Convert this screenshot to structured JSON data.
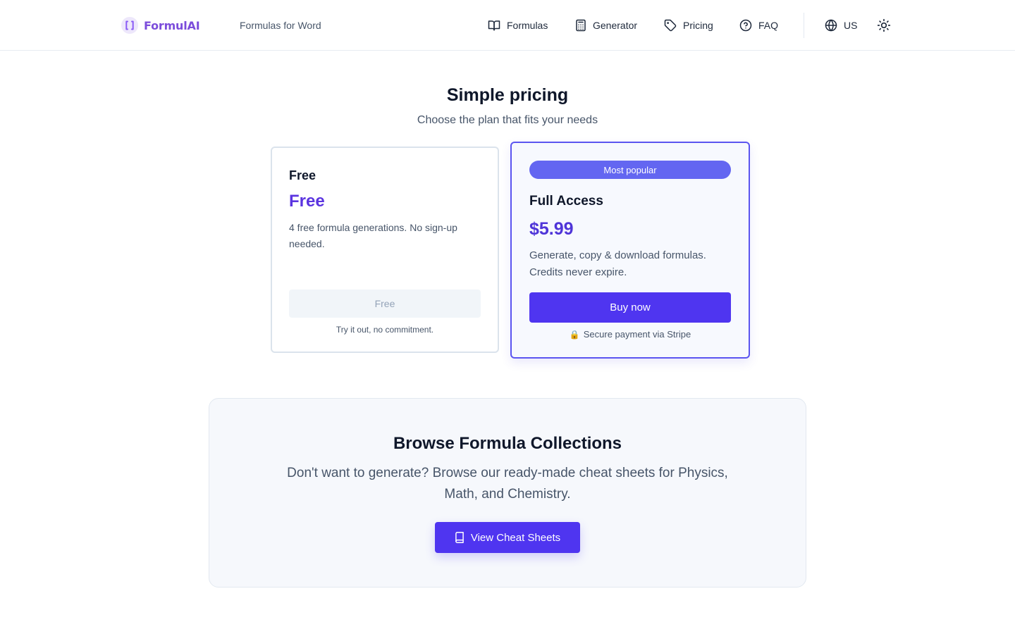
{
  "header": {
    "logo_text": "FormulAI",
    "tagline": "Formulas for Word",
    "nav": [
      {
        "label": "Formulas",
        "icon": "book-open-icon"
      },
      {
        "label": "Generator",
        "icon": "calculator-icon"
      },
      {
        "label": "Pricing",
        "icon": "tag-icon"
      },
      {
        "label": "FAQ",
        "icon": "help-circle-icon"
      }
    ],
    "locale": {
      "label": "US",
      "icon": "globe-icon"
    },
    "theme_icon": "sun-icon"
  },
  "pricing": {
    "title": "Simple pricing",
    "subtitle": "Choose the plan that fits your needs",
    "plans": [
      {
        "name": "Free",
        "price": "Free",
        "description": "4 free formula generations. No sign-up needed.",
        "button_label": "Free",
        "note": "Try it out, no commitment."
      },
      {
        "badge": "Most popular",
        "name": "Full Access",
        "price": "$5.99",
        "description": "Generate, copy & download formulas. Credits never expire.",
        "button_label": "Buy now",
        "note_icon": "🔒",
        "note": "Secure payment via Stripe"
      }
    ]
  },
  "collections": {
    "title": "Browse Formula Collections",
    "description": "Don't want to generate? Browse our ready-made cheat sheets for Physics, Math, and Chemistry.",
    "button_label": "View Cheat Sheets",
    "button_icon": "book-icon"
  },
  "colors": {
    "brand_purple": "#7c4ddb",
    "accent_indigo": "#4f35f0",
    "badge_indigo": "#6366f1",
    "text_dark": "#0f172a",
    "text_muted": "#475569"
  }
}
